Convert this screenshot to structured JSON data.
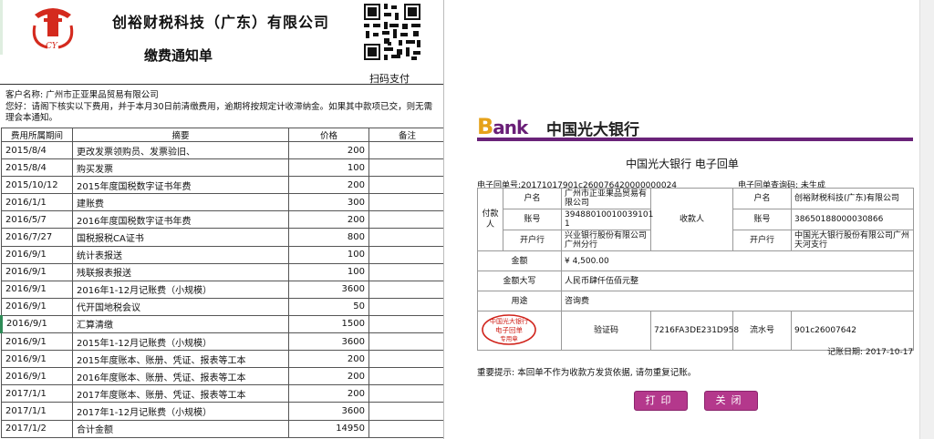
{
  "notice": {
    "company": "创裕财税科技（广东）有限公司",
    "title": "缴费通知单",
    "scan_pay": "扫码支付",
    "customer_label": "客户名称: 广州市正亚果品贸易有限公司",
    "notice_text": "您好：请阁下核实以下费用，并于本月30日前清缴费用，逾期将按规定计收滞纳金。如果其中款项已交，则无需理会本通知。",
    "columns": [
      "费用所属期间",
      "摘要",
      "价格",
      "备注"
    ],
    "rows": [
      {
        "period": "2015/8/4",
        "desc": "更改发票领购员、发票验旧、",
        "price": "200"
      },
      {
        "period": "2015/8/4",
        "desc": "购买发票",
        "price": "100"
      },
      {
        "period": "2015/10/12",
        "desc": "2015年度国税数字证书年费",
        "price": "200"
      },
      {
        "period": "2016/1/1",
        "desc": "建账费",
        "price": "300"
      },
      {
        "period": "2016/5/7",
        "desc": "2016年度国税数字证书年费",
        "price": "200"
      },
      {
        "period": "2016/7/27",
        "desc": "国税报税CA证书",
        "price": "800"
      },
      {
        "period": "2016/9/1",
        "desc": "统计表报送",
        "price": "100"
      },
      {
        "period": "2016/9/1",
        "desc": "残联报表报送",
        "price": "100"
      },
      {
        "period": "2016/9/1",
        "desc": "2016年1-12月记账费（小规模）",
        "price": "3600"
      },
      {
        "period": "2016/9/1",
        "desc": "代开国地税会议",
        "price": "50"
      },
      {
        "period": "2016/9/1",
        "desc": "汇算清缴",
        "price": "1500"
      },
      {
        "period": "2016/9/1",
        "desc": "2015年1-12月记账费（小规模）",
        "price": "3600"
      },
      {
        "period": "2016/9/1",
        "desc": "2015年度账本、账册、凭证、报表等工本",
        "price": "200"
      },
      {
        "period": "2016/9/1",
        "desc": "2016年度账本、账册、凭证、报表等工本",
        "price": "200"
      },
      {
        "period": "2017/1/1",
        "desc": "2017年度账本、账册、凭证、报表等工本",
        "price": "200"
      },
      {
        "period": "2017/1/1",
        "desc": "2017年1-12月记账费（小规模）",
        "price": "3600"
      },
      {
        "period": "2017/1/2",
        "desc": "合计金额",
        "price": "14950"
      }
    ]
  },
  "receipt": {
    "bank_logo_b": "B",
    "bank_logo_rest": "ank",
    "bank_name": "中国光大银行",
    "title": "中国光大银行 电子回单",
    "receipt_no": "电子回单号:20171017901c260076420000000024",
    "query_code": "电子回单查询码: 未生成",
    "payer_label": "付款人",
    "payee_label": "收款人",
    "account_name_label": "户名",
    "account_no_label": "账号",
    "bank_label": "开户行",
    "payer_name": "广州市正亚果品贸易有限公司",
    "payer_account": "39488010010039101​1",
    "payer_bank": "兴业银行股份有限公司广州分行",
    "payee_name": "创裕财税科技(广东)有限公司",
    "payee_account": "38650188000030866",
    "payee_bank": "中国光大银行股份有限公司广州天河支行",
    "amount_label": "金额",
    "amount_value": "¥ 4,500.00",
    "amount_caps_label": "金额大写",
    "amount_caps_value": "人民币肆仟伍佰元整",
    "purpose_label": "用途",
    "purpose_value": "咨询费",
    "stamp_text_1": "中国光大银行",
    "stamp_text_2": "电子回单",
    "stamp_text_3": "专用章",
    "verify_label": "验证码",
    "verify_value": "7216FA3DE231D958",
    "serial_label": "流水号",
    "serial_value": "901c26007642",
    "book_date": "记账日期: 2017-10-17",
    "tip": "重要提示: 本回单不作为收款方发货依据, 请勿重复记账。",
    "print_label": "打印",
    "close_label": "关闭",
    "colors": {
      "brand_purple": "#6a2379",
      "button": "#b4388c",
      "logo_gold": "#e6a21a"
    }
  }
}
